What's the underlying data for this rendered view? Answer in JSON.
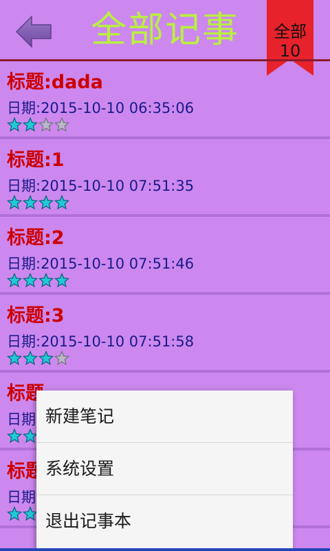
{
  "header": {
    "title": "全部记事",
    "ribbon_label": "全部",
    "ribbon_count": "10",
    "back_icon": "arrow-left-icon",
    "colors": {
      "background": "#cc88ee",
      "title": "#b8f040",
      "ribbon": "#e8222a",
      "divider": "#8a1a2a"
    }
  },
  "notes": [
    {
      "title": "标题:dada",
      "date": "日期:2015-10-10 06:35:06",
      "rating": 2,
      "max_rating": 4
    },
    {
      "title": "标题:1",
      "date": "日期:2015-10-10 07:51:35",
      "rating": 4,
      "max_rating": 4
    },
    {
      "title": "标题:2",
      "date": "日期:2015-10-10 07:51:46",
      "rating": 4,
      "max_rating": 4
    },
    {
      "title": "标题:3",
      "date": "日期:2015-10-10 07:51:58",
      "rating": 3,
      "max_rating": 4
    },
    {
      "title": "标题",
      "date": "日期",
      "rating": 2,
      "max_rating": 4
    },
    {
      "title": "标题",
      "date": "日期",
      "rating": 2,
      "max_rating": 4
    }
  ],
  "menu": {
    "items": [
      {
        "label": "新建笔记"
      },
      {
        "label": "系统设置"
      },
      {
        "label": "退出记事本"
      }
    ]
  }
}
